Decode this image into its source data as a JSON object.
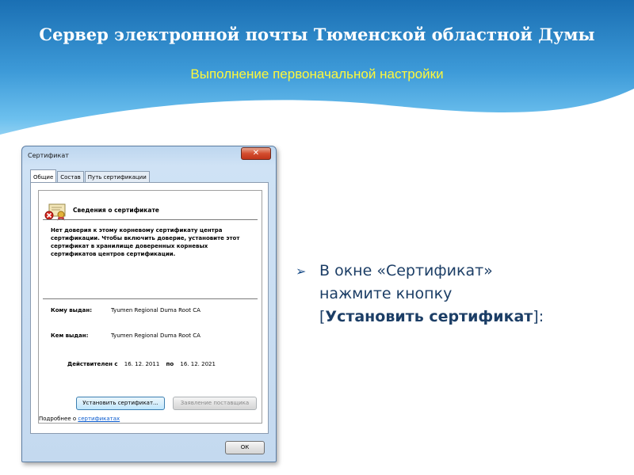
{
  "slide": {
    "title": "Сервер электронной почты Тюменской областной Думы",
    "subtitle": "Выполнение первоначальной настройки",
    "colors": {
      "title": "#ffffff",
      "subtitle": "#fff83a",
      "bullet_text": "#1c3e66",
      "header_blue": "#1a6fb3"
    }
  },
  "bullet": {
    "icon": "arrow-icon",
    "line1": "В окне «Сертификат»",
    "line2": "нажмите кнопку",
    "line3_open": "[",
    "line3_bold": "Установить сертификат",
    "line3_close": "]:"
  },
  "dialog": {
    "window_title": "Сертификат",
    "close_label": "✕",
    "tabs": [
      {
        "label": "Общие",
        "active": true
      },
      {
        "label": "Состав",
        "active": false
      },
      {
        "label": "Путь сертификации",
        "active": false
      }
    ],
    "icon": "certificate-error-icon",
    "heading": "Сведения о сертификате",
    "warning": "Нет доверия к этому корневому сертификату центра сертификации. Чтобы включить доверие, установите этот сертификат в хранилище доверенных корневых сертификатов центров сертификации.",
    "issued_to_label": "Кому выдан:",
    "issued_to_value": "Tyumen Regional Duma Root CA",
    "issued_by_label": "Кем выдан:",
    "issued_by_value": "Tyumen Regional Duma Root CA",
    "valid_from_label": "Действителен с",
    "valid_from_value": "16. 12. 2011",
    "valid_to_label": "по",
    "valid_to_value": "16. 12. 2021",
    "install_button": "Установить сертификат...",
    "issuer_statement_button": "Заявление поставщика",
    "more_prefix": "Подробнее о",
    "more_link": "сертификатах",
    "ok_button": "ОК"
  }
}
